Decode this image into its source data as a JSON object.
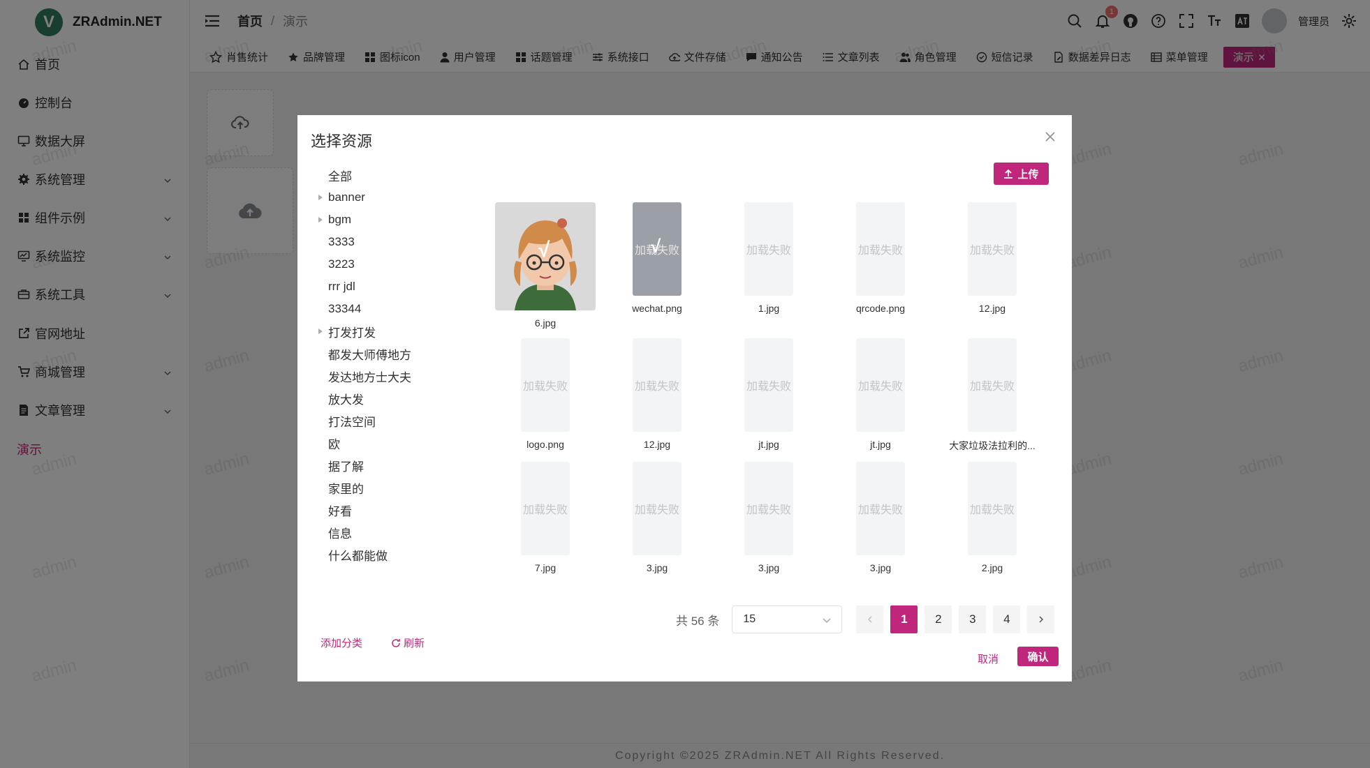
{
  "app": {
    "logo_letter": "V",
    "name": "ZRAdmin.NET",
    "brand_color": "#c0267c"
  },
  "sidebar": {
    "items": [
      {
        "label": "首页",
        "icon": "home-icon"
      },
      {
        "label": "控制台",
        "icon": "dashboard-icon"
      },
      {
        "label": "数据大屏",
        "icon": "monitor-icon"
      },
      {
        "label": "系统管理",
        "icon": "gear-icon"
      },
      {
        "label": "组件示例",
        "icon": "grid-icon"
      },
      {
        "label": "系统监控",
        "icon": "monitor-chart-icon"
      },
      {
        "label": "系统工具",
        "icon": "toolbox-icon"
      },
      {
        "label": "官网地址",
        "icon": "external-link-icon"
      },
      {
        "label": "商城管理",
        "icon": "cart-icon"
      },
      {
        "label": "文章管理",
        "icon": "document-icon"
      },
      {
        "label": "演示",
        "icon": ""
      }
    ]
  },
  "header": {
    "breadcrumb_home": "首页",
    "breadcrumb_sep": "/",
    "breadcrumb_current": "演示",
    "notification_count": "1",
    "username": "管理员"
  },
  "tags": [
    {
      "label": "肖售统计",
      "icon": "star-outline-icon"
    },
    {
      "label": "品牌管理",
      "icon": "star-icon"
    },
    {
      "label": "图标icon",
      "icon": "grid-icon"
    },
    {
      "label": "用户管理",
      "icon": "user-icon"
    },
    {
      "label": "话题管理",
      "icon": "grid-icon"
    },
    {
      "label": "系统接口",
      "icon": "sliders-icon"
    },
    {
      "label": "文件存储",
      "icon": "cloud-icon"
    },
    {
      "label": "通知公告",
      "icon": "message-icon"
    },
    {
      "label": "文章列表",
      "icon": "list-icon"
    },
    {
      "label": "角色管理",
      "icon": "users-icon"
    },
    {
      "label": "短信记录",
      "icon": "check-circle-icon"
    },
    {
      "label": "数据差异日志",
      "icon": "edit-icon"
    },
    {
      "label": "菜单管理",
      "icon": "table-icon"
    },
    {
      "label": "演示",
      "icon": "close-icon"
    }
  ],
  "watermark_text": "admin",
  "footer": {
    "copyright": "Copyright ©2025 ZRAdmin.NET All Rights Reserved."
  },
  "dialog": {
    "title": "选择资源",
    "upload_label": "上传",
    "tree": [
      {
        "label": "全部",
        "expandable": false
      },
      {
        "label": "banner",
        "expandable": true
      },
      {
        "label": "bgm",
        "expandable": true
      },
      {
        "label": "3333",
        "expandable": false
      },
      {
        "label": "3223",
        "expandable": false
      },
      {
        "label": "rrr jdl",
        "expandable": false
      },
      {
        "label": "33344",
        "expandable": false
      },
      {
        "label": "打发打发",
        "expandable": true
      },
      {
        "label": "都发大师傅地方",
        "expandable": false
      },
      {
        "label": "发达地方士大夫",
        "expandable": false
      },
      {
        "label": "放大发",
        "expandable": false
      },
      {
        "label": "打法空间",
        "expandable": false
      },
      {
        "label": "欧",
        "expandable": false
      },
      {
        "label": "据了解",
        "expandable": false
      },
      {
        "label": "家里的",
        "expandable": false
      },
      {
        "label": "好看",
        "expandable": false
      },
      {
        "label": "信息",
        "expandable": false
      },
      {
        "label": "什么都能做",
        "expandable": false
      }
    ],
    "load_fail_text": "加载失败",
    "check_mark": "√",
    "files": [
      {
        "name": "6.jpg",
        "kind": "image",
        "selected": true
      },
      {
        "name": "wechat.png",
        "kind": "failed",
        "selected": true
      },
      {
        "name": "1.jpg",
        "kind": "failed",
        "selected": false
      },
      {
        "name": "qrcode.png",
        "kind": "failed",
        "selected": false
      },
      {
        "name": "12.jpg",
        "kind": "failed",
        "selected": false
      },
      {
        "name": "logo.png",
        "kind": "failed",
        "selected": false
      },
      {
        "name": "12.jpg",
        "kind": "failed",
        "selected": false
      },
      {
        "name": "jt.jpg",
        "kind": "failed",
        "selected": false
      },
      {
        "name": "jt.jpg",
        "kind": "failed",
        "selected": false
      },
      {
        "name": "大家垃圾法拉利的...",
        "kind": "failed",
        "selected": false
      },
      {
        "name": "7.jpg",
        "kind": "failed",
        "selected": false
      },
      {
        "name": "3.jpg",
        "kind": "failed",
        "selected": false
      },
      {
        "name": "3.jpg",
        "kind": "failed",
        "selected": false
      },
      {
        "name": "3.jpg",
        "kind": "failed",
        "selected": false
      },
      {
        "name": "2.jpg",
        "kind": "failed",
        "selected": false
      }
    ],
    "pagination": {
      "total_text": "共 56 条",
      "page_size": "15",
      "pages": [
        "1",
        "2",
        "3",
        "4"
      ],
      "current_page": "1"
    },
    "add_category_label": "添加分类",
    "refresh_label": "刷新",
    "cancel_label": "取消",
    "confirm_label": "确认"
  }
}
